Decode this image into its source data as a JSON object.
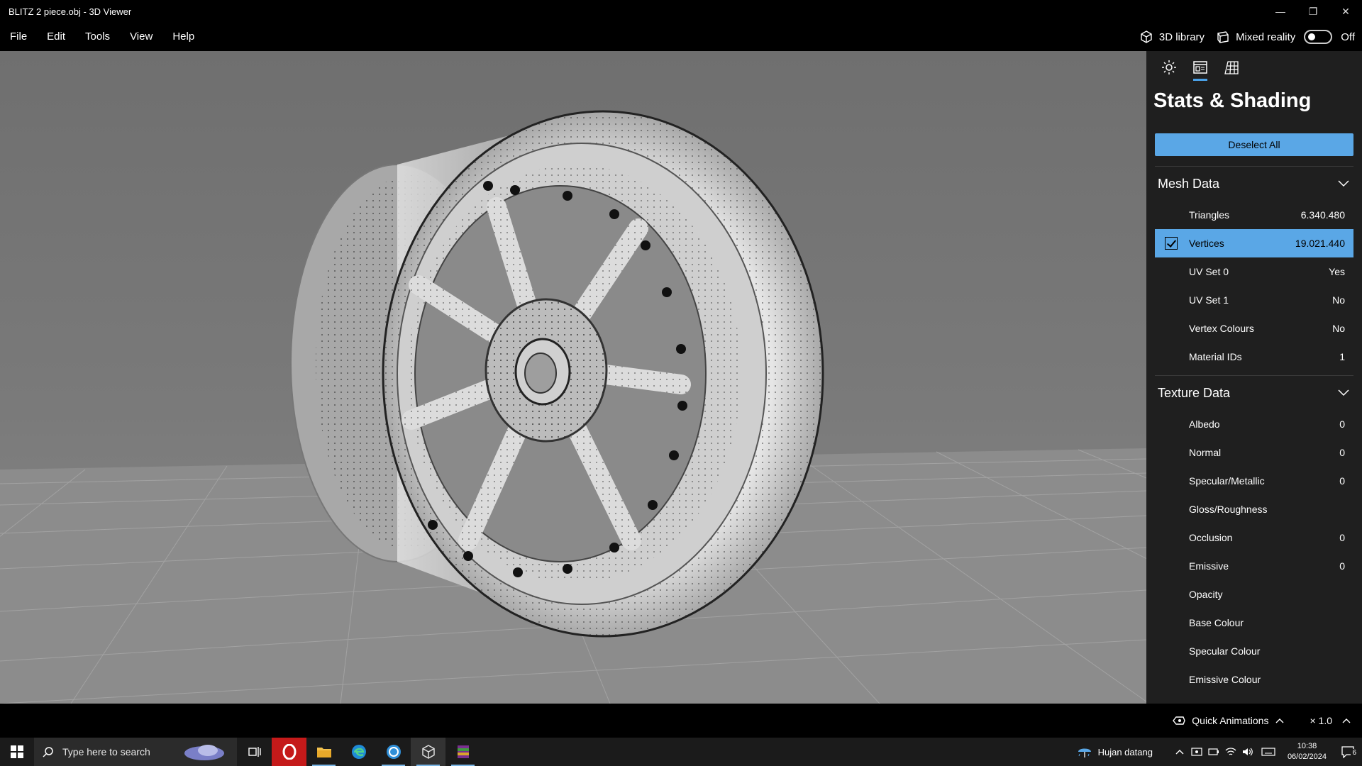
{
  "window": {
    "title": "BLITZ 2 piece.obj - 3D Viewer",
    "minimize_glyph": "—",
    "restore_glyph": "❐",
    "close_glyph": "✕"
  },
  "menu": {
    "items": [
      "File",
      "Edit",
      "Tools",
      "View",
      "Help"
    ],
    "library_label": "3D library",
    "mixed_reality_label": "Mixed reality",
    "mixed_reality_state": "Off"
  },
  "panel": {
    "title": "Stats & Shading",
    "deselect_label": "Deselect All",
    "mesh_section": "Mesh Data",
    "mesh_rows": [
      {
        "label": "Triangles",
        "value": "6.340.480"
      },
      {
        "label": "Vertices",
        "value": "19.021.440"
      },
      {
        "label": "UV Set 0",
        "value": "Yes"
      },
      {
        "label": "UV Set 1",
        "value": "No"
      },
      {
        "label": "Vertex Colours",
        "value": "No"
      },
      {
        "label": "Material IDs",
        "value": "1"
      }
    ],
    "texture_section": "Texture Data",
    "texture_rows": [
      {
        "label": "Albedo",
        "value": "0"
      },
      {
        "label": "Normal",
        "value": "0"
      },
      {
        "label": "Specular/Metallic",
        "value": "0"
      },
      {
        "label": "Gloss/Roughness",
        "value": ""
      },
      {
        "label": "Occlusion",
        "value": "0"
      },
      {
        "label": "Emissive",
        "value": "0"
      },
      {
        "label": "Opacity",
        "value": ""
      },
      {
        "label": "Base Colour",
        "value": ""
      },
      {
        "label": "Specular Colour",
        "value": ""
      },
      {
        "label": "Emissive Colour",
        "value": ""
      }
    ],
    "accent_color": "#5aa7e6"
  },
  "statusbar": {
    "quick_animations": "Quick Animations",
    "speed": "× 1.0"
  },
  "taskbar": {
    "search_placeholder": "Type here to search",
    "weather": "Hujan datang",
    "time": "10:38",
    "date": "06/02/2024",
    "notification_count": "6"
  }
}
